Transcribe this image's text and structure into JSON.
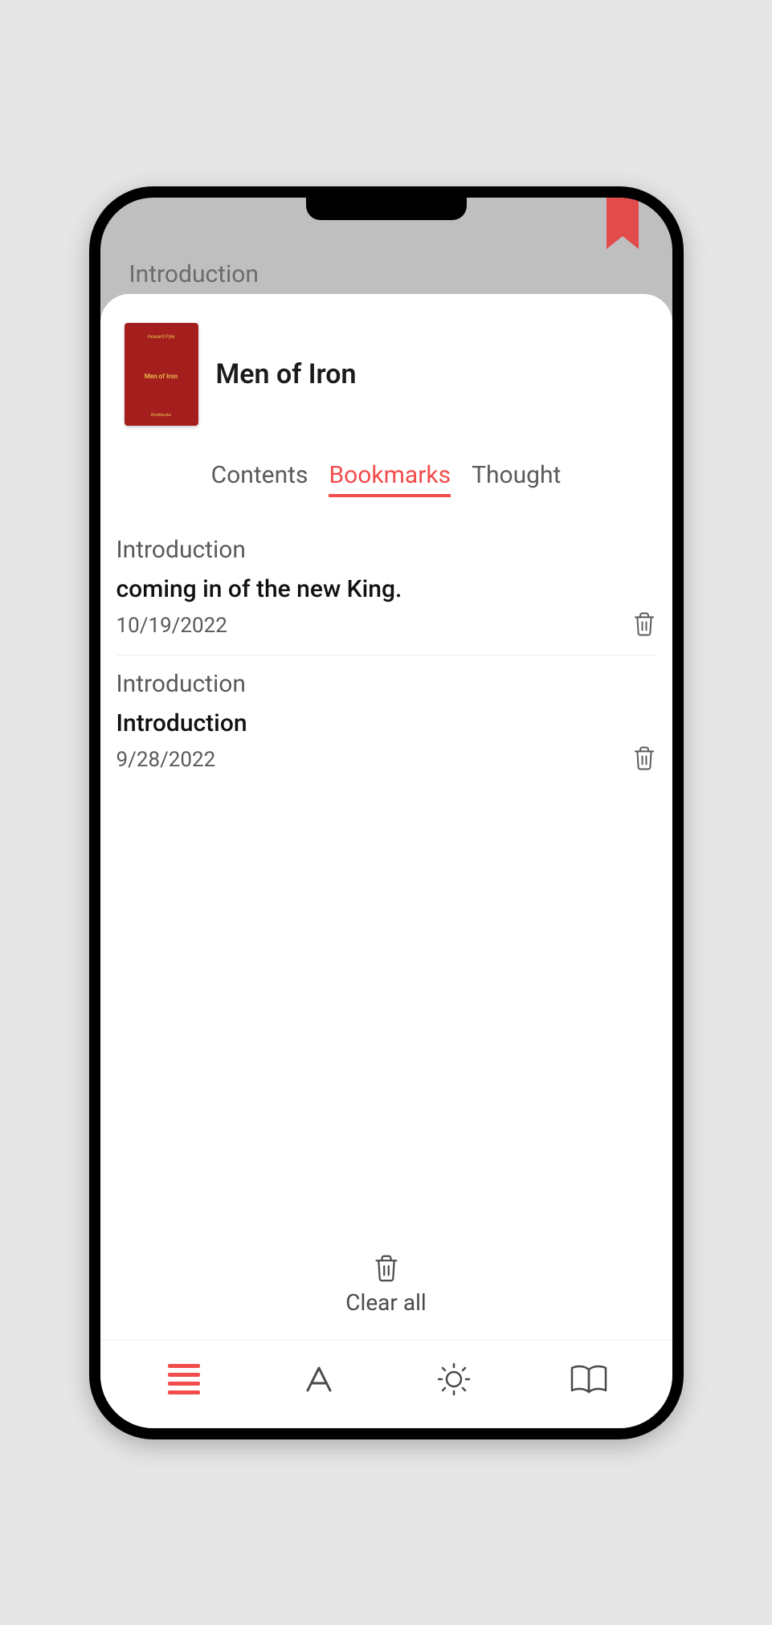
{
  "peek_chapter": "Introduction",
  "book": {
    "title": "Men of Iron",
    "cover_author": "Howard Pyle",
    "cover_title": "Men of Iron",
    "cover_publisher": "Bookbooks"
  },
  "tabs": {
    "contents": "Contents",
    "bookmarks": "Bookmarks",
    "thought": "Thought"
  },
  "bookmarks": [
    {
      "chapter": "Introduction",
      "snippet": "coming in of the new King.",
      "date": "10/19/2022"
    },
    {
      "chapter": "Introduction",
      "snippet": "Introduction",
      "date": "9/28/2022"
    }
  ],
  "clear_all_label": "Clear all",
  "colors": {
    "accent": "#f24c4c"
  }
}
